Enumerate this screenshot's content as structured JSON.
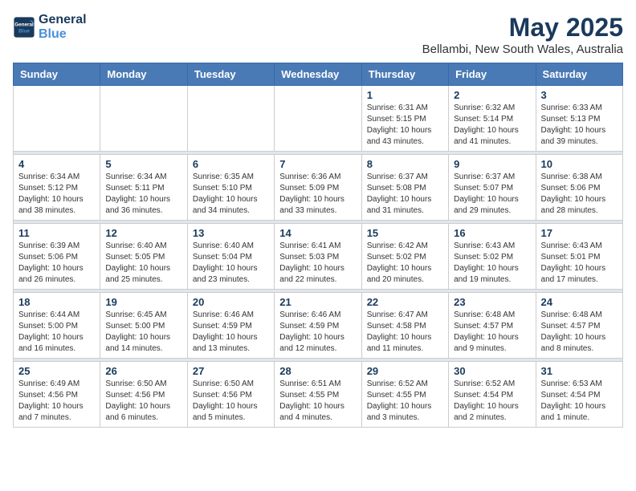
{
  "logo": {
    "line1": "General",
    "line2": "Blue"
  },
  "title": "May 2025",
  "location": "Bellambi, New South Wales, Australia",
  "weekdays": [
    "Sunday",
    "Monday",
    "Tuesday",
    "Wednesday",
    "Thursday",
    "Friday",
    "Saturday"
  ],
  "weeks": [
    [
      {
        "day": "",
        "info": ""
      },
      {
        "day": "",
        "info": ""
      },
      {
        "day": "",
        "info": ""
      },
      {
        "day": "",
        "info": ""
      },
      {
        "day": "1",
        "info": "Sunrise: 6:31 AM\nSunset: 5:15 PM\nDaylight: 10 hours\nand 43 minutes."
      },
      {
        "day": "2",
        "info": "Sunrise: 6:32 AM\nSunset: 5:14 PM\nDaylight: 10 hours\nand 41 minutes."
      },
      {
        "day": "3",
        "info": "Sunrise: 6:33 AM\nSunset: 5:13 PM\nDaylight: 10 hours\nand 39 minutes."
      }
    ],
    [
      {
        "day": "4",
        "info": "Sunrise: 6:34 AM\nSunset: 5:12 PM\nDaylight: 10 hours\nand 38 minutes."
      },
      {
        "day": "5",
        "info": "Sunrise: 6:34 AM\nSunset: 5:11 PM\nDaylight: 10 hours\nand 36 minutes."
      },
      {
        "day": "6",
        "info": "Sunrise: 6:35 AM\nSunset: 5:10 PM\nDaylight: 10 hours\nand 34 minutes."
      },
      {
        "day": "7",
        "info": "Sunrise: 6:36 AM\nSunset: 5:09 PM\nDaylight: 10 hours\nand 33 minutes."
      },
      {
        "day": "8",
        "info": "Sunrise: 6:37 AM\nSunset: 5:08 PM\nDaylight: 10 hours\nand 31 minutes."
      },
      {
        "day": "9",
        "info": "Sunrise: 6:37 AM\nSunset: 5:07 PM\nDaylight: 10 hours\nand 29 minutes."
      },
      {
        "day": "10",
        "info": "Sunrise: 6:38 AM\nSunset: 5:06 PM\nDaylight: 10 hours\nand 28 minutes."
      }
    ],
    [
      {
        "day": "11",
        "info": "Sunrise: 6:39 AM\nSunset: 5:06 PM\nDaylight: 10 hours\nand 26 minutes."
      },
      {
        "day": "12",
        "info": "Sunrise: 6:40 AM\nSunset: 5:05 PM\nDaylight: 10 hours\nand 25 minutes."
      },
      {
        "day": "13",
        "info": "Sunrise: 6:40 AM\nSunset: 5:04 PM\nDaylight: 10 hours\nand 23 minutes."
      },
      {
        "day": "14",
        "info": "Sunrise: 6:41 AM\nSunset: 5:03 PM\nDaylight: 10 hours\nand 22 minutes."
      },
      {
        "day": "15",
        "info": "Sunrise: 6:42 AM\nSunset: 5:02 PM\nDaylight: 10 hours\nand 20 minutes."
      },
      {
        "day": "16",
        "info": "Sunrise: 6:43 AM\nSunset: 5:02 PM\nDaylight: 10 hours\nand 19 minutes."
      },
      {
        "day": "17",
        "info": "Sunrise: 6:43 AM\nSunset: 5:01 PM\nDaylight: 10 hours\nand 17 minutes."
      }
    ],
    [
      {
        "day": "18",
        "info": "Sunrise: 6:44 AM\nSunset: 5:00 PM\nDaylight: 10 hours\nand 16 minutes."
      },
      {
        "day": "19",
        "info": "Sunrise: 6:45 AM\nSunset: 5:00 PM\nDaylight: 10 hours\nand 14 minutes."
      },
      {
        "day": "20",
        "info": "Sunrise: 6:46 AM\nSunset: 4:59 PM\nDaylight: 10 hours\nand 13 minutes."
      },
      {
        "day": "21",
        "info": "Sunrise: 6:46 AM\nSunset: 4:59 PM\nDaylight: 10 hours\nand 12 minutes."
      },
      {
        "day": "22",
        "info": "Sunrise: 6:47 AM\nSunset: 4:58 PM\nDaylight: 10 hours\nand 11 minutes."
      },
      {
        "day": "23",
        "info": "Sunrise: 6:48 AM\nSunset: 4:57 PM\nDaylight: 10 hours\nand 9 minutes."
      },
      {
        "day": "24",
        "info": "Sunrise: 6:48 AM\nSunset: 4:57 PM\nDaylight: 10 hours\nand 8 minutes."
      }
    ],
    [
      {
        "day": "25",
        "info": "Sunrise: 6:49 AM\nSunset: 4:56 PM\nDaylight: 10 hours\nand 7 minutes."
      },
      {
        "day": "26",
        "info": "Sunrise: 6:50 AM\nSunset: 4:56 PM\nDaylight: 10 hours\nand 6 minutes."
      },
      {
        "day": "27",
        "info": "Sunrise: 6:50 AM\nSunset: 4:56 PM\nDaylight: 10 hours\nand 5 minutes."
      },
      {
        "day": "28",
        "info": "Sunrise: 6:51 AM\nSunset: 4:55 PM\nDaylight: 10 hours\nand 4 minutes."
      },
      {
        "day": "29",
        "info": "Sunrise: 6:52 AM\nSunset: 4:55 PM\nDaylight: 10 hours\nand 3 minutes."
      },
      {
        "day": "30",
        "info": "Sunrise: 6:52 AM\nSunset: 4:54 PM\nDaylight: 10 hours\nand 2 minutes."
      },
      {
        "day": "31",
        "info": "Sunrise: 6:53 AM\nSunset: 4:54 PM\nDaylight: 10 hours\nand 1 minute."
      }
    ]
  ]
}
